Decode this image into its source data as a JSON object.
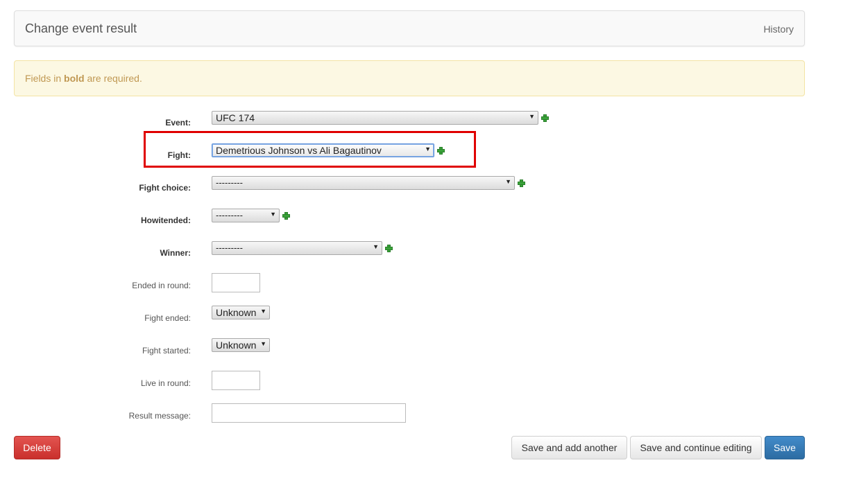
{
  "header": {
    "title": "Change event result",
    "history_label": "History"
  },
  "alert": {
    "prefix": "Fields in ",
    "bold_word": "bold",
    "suffix": " are required."
  },
  "fields": {
    "event": {
      "label": "Event:",
      "value": "UFC 174"
    },
    "fight": {
      "label": "Fight:",
      "value": "Demetrious Johnson vs Ali Bagautinov"
    },
    "fight_choice": {
      "label": "Fight choice:",
      "value": "---------"
    },
    "howitended": {
      "label": "Howitended:",
      "value": "---------"
    },
    "winner": {
      "label": "Winner:",
      "value": "---------"
    },
    "ended_in_round": {
      "label": "Ended in round:",
      "value": ""
    },
    "fight_ended": {
      "label": "Fight ended:",
      "value": "Unknown"
    },
    "fight_started": {
      "label": "Fight started:",
      "value": "Unknown"
    },
    "live_in_round": {
      "label": "Live in round:",
      "value": ""
    },
    "result_message": {
      "label": "Result message:",
      "value": ""
    }
  },
  "buttons": {
    "delete": "Delete",
    "save_add_another": "Save and add another",
    "save_continue": "Save and continue editing",
    "save": "Save"
  },
  "icons": {
    "add": "plus-icon",
    "dropdown": "dropdown-arrow-icon"
  },
  "colors": {
    "highlight": "#e00000",
    "add_green": "#3aa33a",
    "primary": "#428bca",
    "danger": "#d9534f",
    "alert_bg": "#fcf8e3"
  }
}
